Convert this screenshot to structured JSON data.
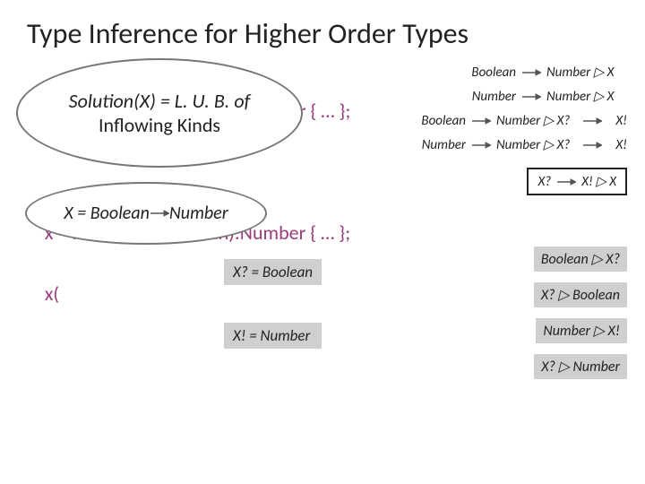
{
  "title": "Type Inference for Higher Order Types",
  "ellipse1": {
    "line1_pre": "Solution(X)",
    "line1_post": " = L. U. B. of",
    "line2": "Inflowing Kinds"
  },
  "ellipse2_pre": "X = Boolean",
  "ellipse2_post": "Number",
  "code": {
    "frag1": "r):Number { … };",
    "line2": "x = function (x:Boolean):Number { … };",
    "line3_frag": "x("
  },
  "flows": [
    {
      "lhs": "Boolean",
      "rhs": "Number ▷ X",
      "ex": ""
    },
    {
      "lhs": "Number",
      "rhs": "Number ▷ X",
      "ex": ""
    },
    {
      "lhs": "Boolean",
      "rhs": "Number ▷ X?",
      "ex": "X!"
    },
    {
      "lhs": "Number",
      "rhs": "Number ▷ X?",
      "ex": "X!"
    }
  ],
  "boxed": {
    "lhs": "X?",
    "rhs": "X! ▷ X"
  },
  "right_rels": [
    "Boolean ▷ X?",
    "X? ▷ Boolean",
    "Number ▷ X!",
    "X? ▷ Number"
  ],
  "solutions": {
    "xq": "X? = Boolean",
    "xe": "X! = Number"
  }
}
